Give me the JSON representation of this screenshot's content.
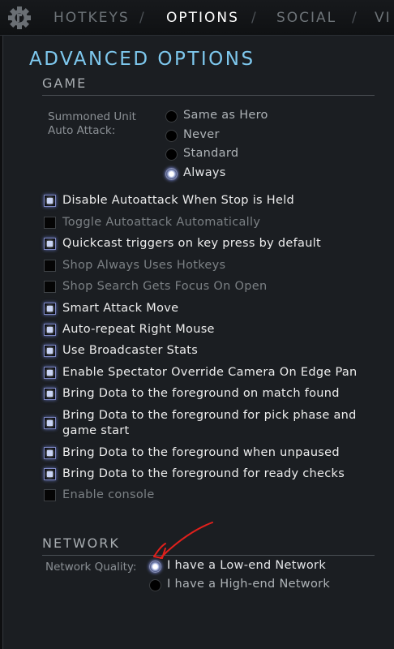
{
  "tabs": [
    {
      "label": "HOTKEYS",
      "active": false
    },
    {
      "label": "OPTIONS",
      "active": true
    },
    {
      "label": "SOCIAL",
      "active": false
    },
    {
      "label": "VI",
      "active": false
    }
  ],
  "separator": "/",
  "page_title": "ADVANCED OPTIONS",
  "game": {
    "title": "GAME",
    "summoned_label_line1": "Summoned Unit",
    "summoned_label_line2": "Auto Attack:",
    "summoned_options": [
      {
        "label": "Same as Hero",
        "selected": false
      },
      {
        "label": "Never",
        "selected": false
      },
      {
        "label": "Standard",
        "selected": false
      },
      {
        "label": "Always",
        "selected": true
      }
    ],
    "checkboxes": [
      {
        "label": "Disable Autoattack When Stop is Held",
        "checked": true
      },
      {
        "label": "Toggle Autoattack Automatically",
        "checked": false
      },
      {
        "label": "Quickcast triggers on key press by default",
        "checked": true
      },
      {
        "label": "Shop Always Uses Hotkeys",
        "checked": false
      },
      {
        "label": "Shop Search Gets Focus On Open",
        "checked": false
      },
      {
        "label": "Smart Attack Move",
        "checked": true
      },
      {
        "label": "Auto-repeat Right Mouse",
        "checked": true
      },
      {
        "label": "Use Broadcaster Stats",
        "checked": true
      },
      {
        "label": "Enable Spectator Override Camera On Edge Pan",
        "checked": true
      },
      {
        "label": "Bring Dota to the foreground on match found",
        "checked": true
      },
      {
        "label": "Bring Dota to the foreground for pick phase and",
        "label_line2": "game start",
        "checked": true
      },
      {
        "label": "Bring Dota to the foreground when unpaused",
        "checked": true
      },
      {
        "label": "Bring Dota to the foreground for ready checks",
        "checked": true
      },
      {
        "label": "Enable console",
        "checked": false
      }
    ]
  },
  "network": {
    "title": "NETWORK",
    "quality_label": "Network Quality:",
    "options": [
      {
        "label": "I have a Low-end Network",
        "selected": true
      },
      {
        "label": "I have a High-end Network",
        "selected": false
      }
    ]
  },
  "colors": {
    "accent_title": "#7ec8ee",
    "annotation_arrow": "#e0201c"
  },
  "icons": {
    "settings": "gear-icon",
    "annotation": "red-arrow-annotation"
  }
}
